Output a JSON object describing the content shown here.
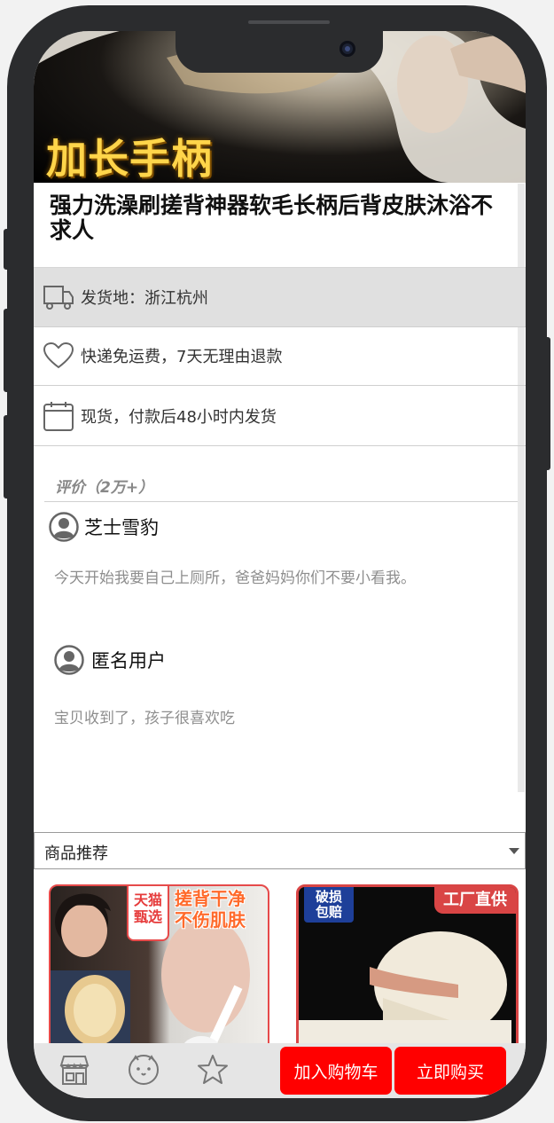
{
  "hero": {
    "overlay_text": "加长手柄"
  },
  "product": {
    "title": "强力洗澡刷搓背神器软毛长柄后背皮肤沐浴不求人"
  },
  "info": [
    {
      "icon": "truck-icon",
      "text": "发货地：浙江杭州"
    },
    {
      "icon": "heart-icon",
      "text": "快递免运费，7天无理由退款"
    },
    {
      "icon": "calendar-icon",
      "text": "现货，付款后48小时内发货"
    }
  ],
  "reviews": {
    "heading": "评价（2万+）",
    "items": [
      {
        "user": "芝士雪豹",
        "text": "今天开始我要自己上厕所，爸爸妈妈你们不要小看我。"
      },
      {
        "user": "匿名用户",
        "text": "宝贝收到了，孩子很喜欢吃"
      }
    ]
  },
  "recommend": {
    "selected": "商品推荐",
    "cards": [
      {
        "badge1": "天猫\n甄选",
        "badge2": "搓背干净\n不伤肌肤"
      },
      {
        "badge1": "破损\n包赔",
        "badge2": "工厂直供"
      }
    ]
  },
  "bottom": {
    "add_to_cart": "加入购物车",
    "buy_now": "立即购买"
  },
  "colors": {
    "accent": "#ff0000",
    "hero_text": "#ffd54a"
  }
}
